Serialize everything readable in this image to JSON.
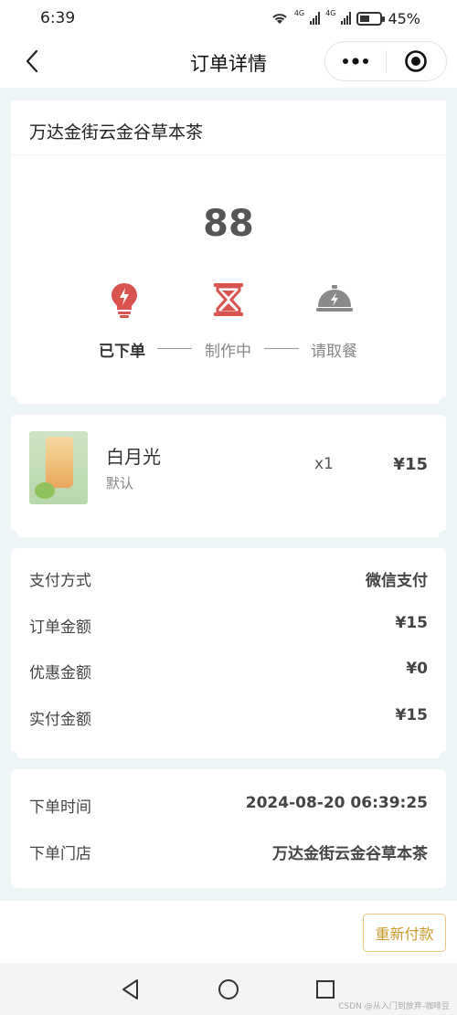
{
  "status_bar": {
    "time": "6:39",
    "net1": "4G",
    "net2": "4G",
    "battery": "45%"
  },
  "nav": {
    "title": "订单详情",
    "more_icon": "more-dots-icon",
    "close_icon": "target-close-icon"
  },
  "store": {
    "name": "万达金街云金谷草本茶"
  },
  "status": {
    "pickup_number": "88",
    "steps": [
      {
        "label": "已下单",
        "icon": "lightbulb-icon",
        "active": true
      },
      {
        "label": "制作中",
        "icon": "hourglass-icon",
        "active": false
      },
      {
        "label": "请取餐",
        "icon": "cloche-bell-icon",
        "active": false
      }
    ]
  },
  "product": {
    "name": "白月光",
    "spec": "默认",
    "qty": "x1",
    "price": "¥15"
  },
  "payment": {
    "rows": [
      {
        "key": "支付方式",
        "value": "微信支付"
      },
      {
        "key": "订单金额",
        "value": "¥15"
      },
      {
        "key": "优惠金额",
        "value": "¥0"
      },
      {
        "key": "实付金额",
        "value": "¥15"
      }
    ]
  },
  "order": {
    "rows": [
      {
        "key": "下单时间",
        "value": "2024-08-20 06:39:25"
      },
      {
        "key": "下单门店",
        "value": "万达金街云金谷草本茶"
      }
    ]
  },
  "actions": {
    "repay_label": "重新付款"
  },
  "watermark": "CSDN @从入门到放弃-咖啡豆",
  "colors": {
    "accent_red": "#d9534f",
    "inactive_gray": "#8a8a8a",
    "repay_border": "#e8c77a",
    "repay_text": "#c99a2e",
    "page_bg": "#edf5f7"
  }
}
